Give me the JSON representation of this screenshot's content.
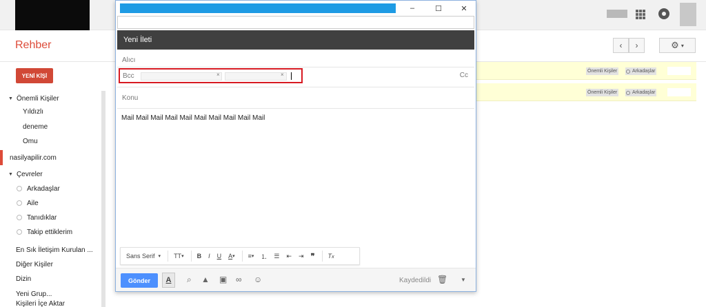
{
  "header": {
    "app_title": "Rehber",
    "prev_icon": "chevron-left-icon",
    "next_icon": "chevron-right-icon",
    "settings_icon": "gear-icon"
  },
  "sidebar": {
    "new_contact_label": "YENİ KİŞİ",
    "important_label": "Önemli Kişiler",
    "important_items": [
      "Yıldızlı",
      "deneme",
      "Omu"
    ],
    "domain_label": "nasilyapilir.com",
    "circles_label": "Çevreler",
    "circles_items": [
      "Arkadaşlar",
      "Aile",
      "Tanıdıklar",
      "Takip ettiklerim"
    ],
    "frequent_label": "En Sık İletişim Kurulan ...",
    "other_label": "Diğer Kişiler",
    "directory_label": "Dizin",
    "new_group_label": "Yeni Grup...",
    "import_label": "Kişileri İçe Aktar"
  },
  "contact_rows": [
    {
      "tag1": "Önemli Kişiler",
      "tag2": "Arkadaşlar"
    },
    {
      "tag1": "Önemli Kişiler",
      "tag2": "Arkadaşlar"
    }
  ],
  "compose": {
    "title": "Yeni İleti",
    "to_label": "Alıcı",
    "bcc_label": "Bcc",
    "cc_label": "Cc",
    "subject_placeholder": "Konu",
    "body": "Mail Mail Mail Mail Mail Mail Mail Mail Mail Mail",
    "minimize_glyph": "–",
    "maximize_glyph": "☐",
    "close_glyph": "✕",
    "font_select": "Sans Serif",
    "send_label": "Gönder",
    "saved_label": "Kaydedildi",
    "chip_remove_glyph": "×"
  },
  "accent_colors": {
    "brand_red": "#dd4b39",
    "send_blue": "#4d90fe",
    "highlight_red": "#d71921"
  }
}
